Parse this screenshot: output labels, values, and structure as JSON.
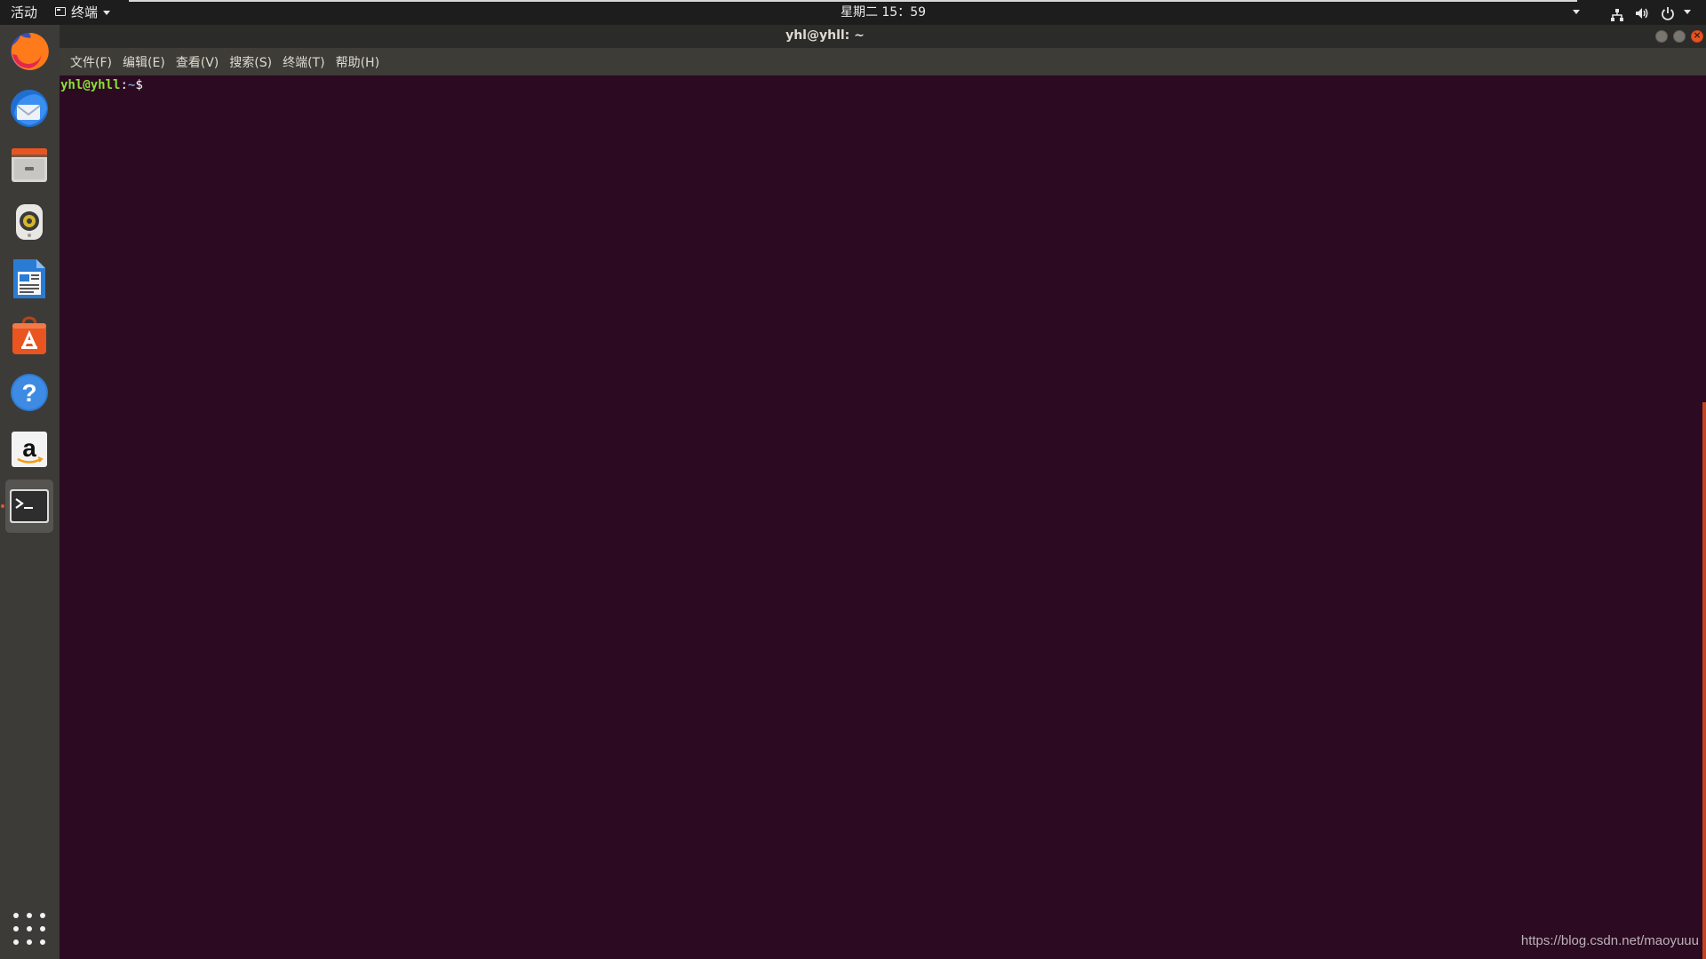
{
  "topbar": {
    "activities": "活动",
    "app_menu_label": "终端",
    "clock": "星期二 15：59"
  },
  "dock": {
    "items": [
      {
        "name": "firefox",
        "icon": "firefox-icon"
      },
      {
        "name": "thunderbird",
        "icon": "thunderbird-mail-icon"
      },
      {
        "name": "files",
        "icon": "files-cabinet-icon"
      },
      {
        "name": "rhythmbox",
        "icon": "rhythmbox-speaker-icon"
      },
      {
        "name": "libreoffice-writer",
        "icon": "writer-document-icon"
      },
      {
        "name": "ubuntu-software",
        "icon": "software-bag-icon"
      },
      {
        "name": "help",
        "icon": "help-question-icon"
      },
      {
        "name": "amazon",
        "icon": "amazon-icon"
      },
      {
        "name": "terminal",
        "icon": "terminal-icon",
        "active": true
      }
    ],
    "show_apps_icon": "apps-grid-icon"
  },
  "window": {
    "title": "yhl@yhll: ~",
    "menu": [
      "文件(F)",
      "编辑(E)",
      "查看(V)",
      "搜索(S)",
      "终端(T)",
      "帮助(H)"
    ]
  },
  "terminal": {
    "prompt_user": "yhl@yhll",
    "prompt_sep": ":",
    "prompt_path": "~",
    "prompt_sign": "$"
  },
  "watermark": "https://blog.csdn.net/maoyuuu",
  "colors": {
    "terminal_bg": "#2c0a22",
    "accent": "#e95420",
    "prompt_user": "#8ae234",
    "prompt_path": "#729fcf"
  }
}
